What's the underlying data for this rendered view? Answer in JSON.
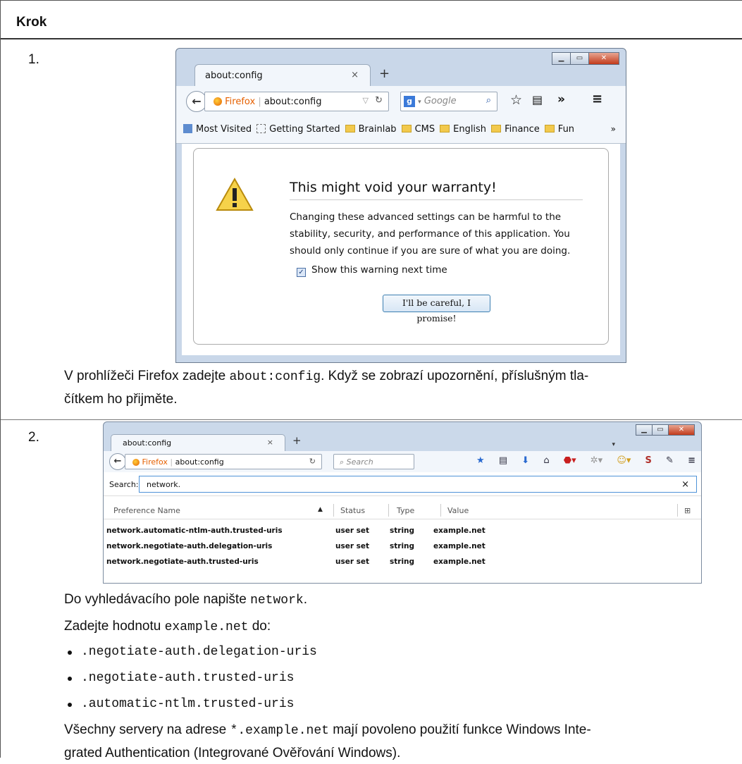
{
  "table": {
    "header": "Krok"
  },
  "step1": {
    "number": "1.",
    "text_before": "V prohlížeči Firefox zadejte ",
    "code": "about:config",
    "text_after": ". Když se zobrazí upozornění, příslušným tla-",
    "text_line2": "čítkem ho přijměte.",
    "screenshot": {
      "tab_title": "about:config",
      "tab_close": "×",
      "new_tab": "+",
      "identity_label": "Firefox",
      "url": "about:config",
      "search_engine": "Google",
      "bookmarks": [
        "Most Visited",
        "Getting Started",
        "Brainlab",
        "CMS",
        "English",
        "Finance",
        "Fun"
      ],
      "bookmarks_overflow": "»",
      "nav_overflow": "»",
      "warning_title": "This might void your warranty!",
      "warning_body": "Changing these advanced settings can be harmful to the stability, security, and performance of this application. You should only continue if you are sure of what you are doing.",
      "checkbox_label": "Show this warning next time",
      "checkbox_checked": true,
      "accept_button": "I'll be careful, I promise!"
    }
  },
  "step2": {
    "number": "2.",
    "line1_text": "Do vyhledávacího pole napište ",
    "line1_code": "network",
    "line1_end": ".",
    "line2_text": "Zadejte hodnotu ",
    "line2_code": "example.net",
    "line2_end": " do:",
    "items": [
      ".negotiate-auth.delegation-uris",
      ".negotiate-auth.trusted-uris",
      ".automatic-ntlm.trusted-uris"
    ],
    "closing_before": "Všechny servery na adrese ",
    "closing_code": "*.example.net",
    "closing_after": " mají povoleno použití funkce Windows Inte-",
    "closing_line2": "grated Authentication (Integrované Ověřování Windows).",
    "screenshot": {
      "tab_title": "about:config",
      "tab_close": "×",
      "new_tab": "+",
      "identity_label": "Firefox",
      "url": "about:config",
      "search_placeholder": "Search",
      "filter_label": "Search:",
      "filter_value": "network.",
      "filter_clear": "×",
      "columns": [
        "Preference Name",
        "Status",
        "Type",
        "Value"
      ],
      "rows": [
        {
          "name": "network.automatic-ntlm-auth.trusted-uris",
          "status": "user set",
          "type": "string",
          "value": "example.net"
        },
        {
          "name": "network.negotiate-auth.delegation-uris",
          "status": "user set",
          "type": "string",
          "value": "example.net"
        },
        {
          "name": "network.negotiate-auth.trusted-uris",
          "status": "user set",
          "type": "string",
          "value": "example.net"
        }
      ]
    }
  }
}
